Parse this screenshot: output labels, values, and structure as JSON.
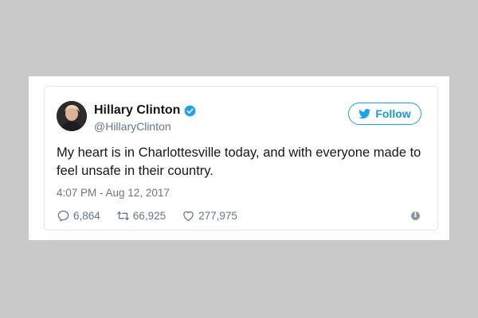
{
  "colors": {
    "background": "#c9c9c9",
    "brand_blue": "#1da1f2",
    "text_primary": "#14171a",
    "text_secondary": "#657786"
  },
  "tweet": {
    "author": {
      "display_name": "Hillary Clinton",
      "handle": "@HillaryClinton",
      "verified": true,
      "avatar_icon": "profile-photo"
    },
    "follow_button": {
      "label": "Follow",
      "icon": "twitter-bird-icon"
    },
    "text_line_1": "My heart is in Charlottesville today, and with everyone made to",
    "text_line_2": "feel unsafe in their country.",
    "timestamp": "4:07 PM - Aug 12, 2017",
    "actions": {
      "replies": "6,864",
      "retweets": "66,925",
      "likes": "277,975"
    },
    "info_icon": "info-icon"
  }
}
